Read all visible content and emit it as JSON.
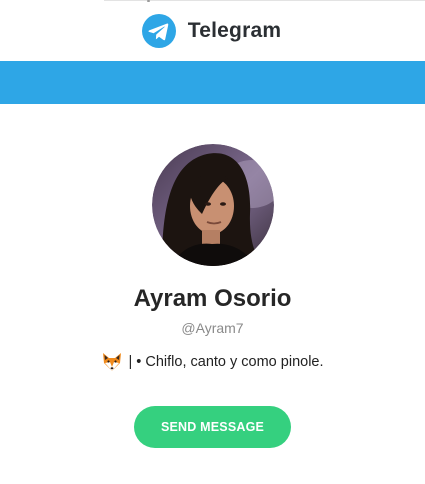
{
  "header": {
    "brand_name": "Telegram",
    "logo_icon": "telegram-plane-icon"
  },
  "colors": {
    "brand_blue": "#2ea6e6",
    "button_green": "#35d07f"
  },
  "profile": {
    "display_name": "Ayram Osorio",
    "username": "@Ayram7",
    "bio_emoji_icon": "fox-face-icon",
    "bio_text": "| • Chiflo, canto y como pinole."
  },
  "actions": {
    "send_message_label": "SEND MESSAGE"
  }
}
